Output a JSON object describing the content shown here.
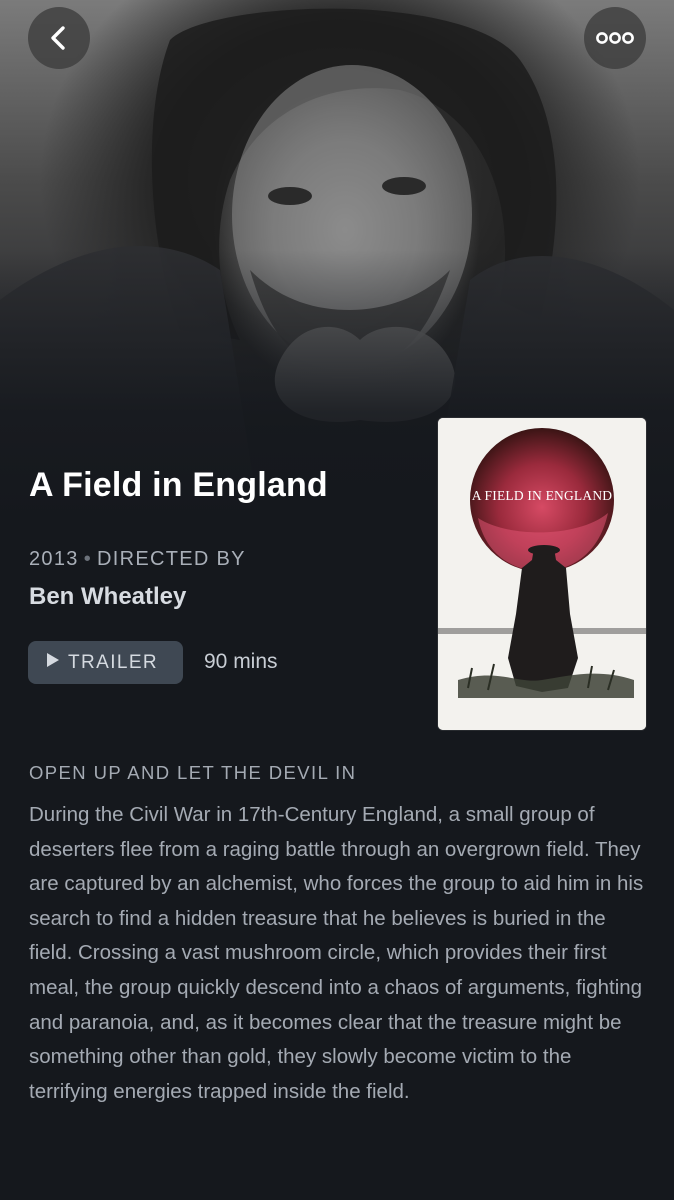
{
  "header": {
    "back_icon": "chevron-left-icon",
    "more_icon": "more-dots-icon"
  },
  "movie": {
    "title": "A Field in England",
    "year": "2013",
    "separator": "•",
    "directed_by_label": "DIRECTED BY",
    "director": "Ben Wheatley",
    "trailer_label": "TRAILER",
    "runtime": "90 mins",
    "poster_title": "A FIELD IN ENGLAND",
    "tagline": "OPEN UP AND LET THE DEVIL IN",
    "synopsis": "During the Civil War in 17th-Century England, a small group of deserters flee from a raging battle through an overgrown field. They are captured by an alchemist, who forces the group to aid him in his search to find a hidden treasure that he believes is buried in the field. Crossing a vast mushroom circle, which provides their first meal, the group quickly descend into a chaos of arguments, fighting and paranoia, and, as it becomes clear that the treasure might be something other than gold, they slowly become victim to the terrifying energies trapped inside the field."
  },
  "colors": {
    "background": "#15181d",
    "trailer_button": "#3f4853",
    "poster_moon": "#c1324f"
  }
}
